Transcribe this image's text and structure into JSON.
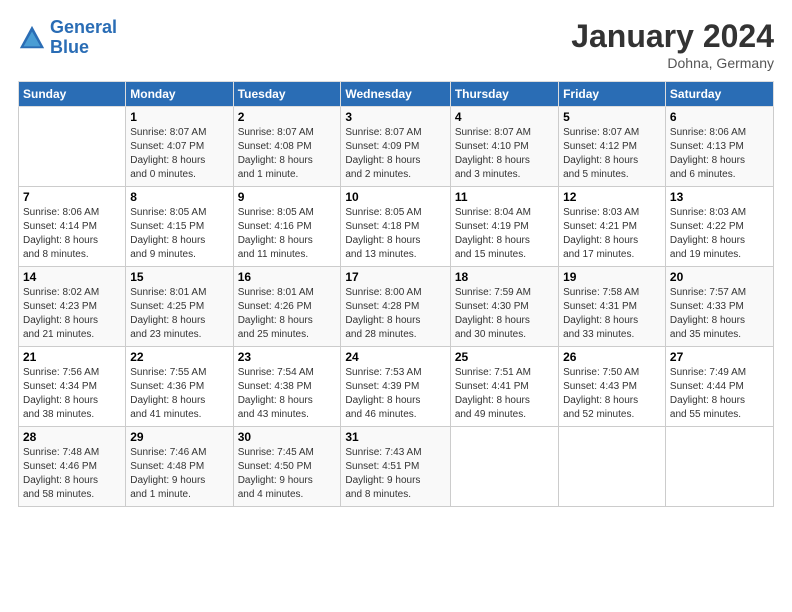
{
  "header": {
    "logo_line1": "General",
    "logo_line2": "Blue",
    "month": "January 2024",
    "location": "Dohna, Germany"
  },
  "days_of_week": [
    "Sunday",
    "Monday",
    "Tuesday",
    "Wednesday",
    "Thursday",
    "Friday",
    "Saturday"
  ],
  "weeks": [
    [
      {
        "day": "",
        "info": ""
      },
      {
        "day": "1",
        "info": "Sunrise: 8:07 AM\nSunset: 4:07 PM\nDaylight: 8 hours\nand 0 minutes."
      },
      {
        "day": "2",
        "info": "Sunrise: 8:07 AM\nSunset: 4:08 PM\nDaylight: 8 hours\nand 1 minute."
      },
      {
        "day": "3",
        "info": "Sunrise: 8:07 AM\nSunset: 4:09 PM\nDaylight: 8 hours\nand 2 minutes."
      },
      {
        "day": "4",
        "info": "Sunrise: 8:07 AM\nSunset: 4:10 PM\nDaylight: 8 hours\nand 3 minutes."
      },
      {
        "day": "5",
        "info": "Sunrise: 8:07 AM\nSunset: 4:12 PM\nDaylight: 8 hours\nand 5 minutes."
      },
      {
        "day": "6",
        "info": "Sunrise: 8:06 AM\nSunset: 4:13 PM\nDaylight: 8 hours\nand 6 minutes."
      }
    ],
    [
      {
        "day": "7",
        "info": "Sunrise: 8:06 AM\nSunset: 4:14 PM\nDaylight: 8 hours\nand 8 minutes."
      },
      {
        "day": "8",
        "info": "Sunrise: 8:05 AM\nSunset: 4:15 PM\nDaylight: 8 hours\nand 9 minutes."
      },
      {
        "day": "9",
        "info": "Sunrise: 8:05 AM\nSunset: 4:16 PM\nDaylight: 8 hours\nand 11 minutes."
      },
      {
        "day": "10",
        "info": "Sunrise: 8:05 AM\nSunset: 4:18 PM\nDaylight: 8 hours\nand 13 minutes."
      },
      {
        "day": "11",
        "info": "Sunrise: 8:04 AM\nSunset: 4:19 PM\nDaylight: 8 hours\nand 15 minutes."
      },
      {
        "day": "12",
        "info": "Sunrise: 8:03 AM\nSunset: 4:21 PM\nDaylight: 8 hours\nand 17 minutes."
      },
      {
        "day": "13",
        "info": "Sunrise: 8:03 AM\nSunset: 4:22 PM\nDaylight: 8 hours\nand 19 minutes."
      }
    ],
    [
      {
        "day": "14",
        "info": "Sunrise: 8:02 AM\nSunset: 4:23 PM\nDaylight: 8 hours\nand 21 minutes."
      },
      {
        "day": "15",
        "info": "Sunrise: 8:01 AM\nSunset: 4:25 PM\nDaylight: 8 hours\nand 23 minutes."
      },
      {
        "day": "16",
        "info": "Sunrise: 8:01 AM\nSunset: 4:26 PM\nDaylight: 8 hours\nand 25 minutes."
      },
      {
        "day": "17",
        "info": "Sunrise: 8:00 AM\nSunset: 4:28 PM\nDaylight: 8 hours\nand 28 minutes."
      },
      {
        "day": "18",
        "info": "Sunrise: 7:59 AM\nSunset: 4:30 PM\nDaylight: 8 hours\nand 30 minutes."
      },
      {
        "day": "19",
        "info": "Sunrise: 7:58 AM\nSunset: 4:31 PM\nDaylight: 8 hours\nand 33 minutes."
      },
      {
        "day": "20",
        "info": "Sunrise: 7:57 AM\nSunset: 4:33 PM\nDaylight: 8 hours\nand 35 minutes."
      }
    ],
    [
      {
        "day": "21",
        "info": "Sunrise: 7:56 AM\nSunset: 4:34 PM\nDaylight: 8 hours\nand 38 minutes."
      },
      {
        "day": "22",
        "info": "Sunrise: 7:55 AM\nSunset: 4:36 PM\nDaylight: 8 hours\nand 41 minutes."
      },
      {
        "day": "23",
        "info": "Sunrise: 7:54 AM\nSunset: 4:38 PM\nDaylight: 8 hours\nand 43 minutes."
      },
      {
        "day": "24",
        "info": "Sunrise: 7:53 AM\nSunset: 4:39 PM\nDaylight: 8 hours\nand 46 minutes."
      },
      {
        "day": "25",
        "info": "Sunrise: 7:51 AM\nSunset: 4:41 PM\nDaylight: 8 hours\nand 49 minutes."
      },
      {
        "day": "26",
        "info": "Sunrise: 7:50 AM\nSunset: 4:43 PM\nDaylight: 8 hours\nand 52 minutes."
      },
      {
        "day": "27",
        "info": "Sunrise: 7:49 AM\nSunset: 4:44 PM\nDaylight: 8 hours\nand 55 minutes."
      }
    ],
    [
      {
        "day": "28",
        "info": "Sunrise: 7:48 AM\nSunset: 4:46 PM\nDaylight: 8 hours\nand 58 minutes."
      },
      {
        "day": "29",
        "info": "Sunrise: 7:46 AM\nSunset: 4:48 PM\nDaylight: 9 hours\nand 1 minute."
      },
      {
        "day": "30",
        "info": "Sunrise: 7:45 AM\nSunset: 4:50 PM\nDaylight: 9 hours\nand 4 minutes."
      },
      {
        "day": "31",
        "info": "Sunrise: 7:43 AM\nSunset: 4:51 PM\nDaylight: 9 hours\nand 8 minutes."
      },
      {
        "day": "",
        "info": ""
      },
      {
        "day": "",
        "info": ""
      },
      {
        "day": "",
        "info": ""
      }
    ]
  ]
}
